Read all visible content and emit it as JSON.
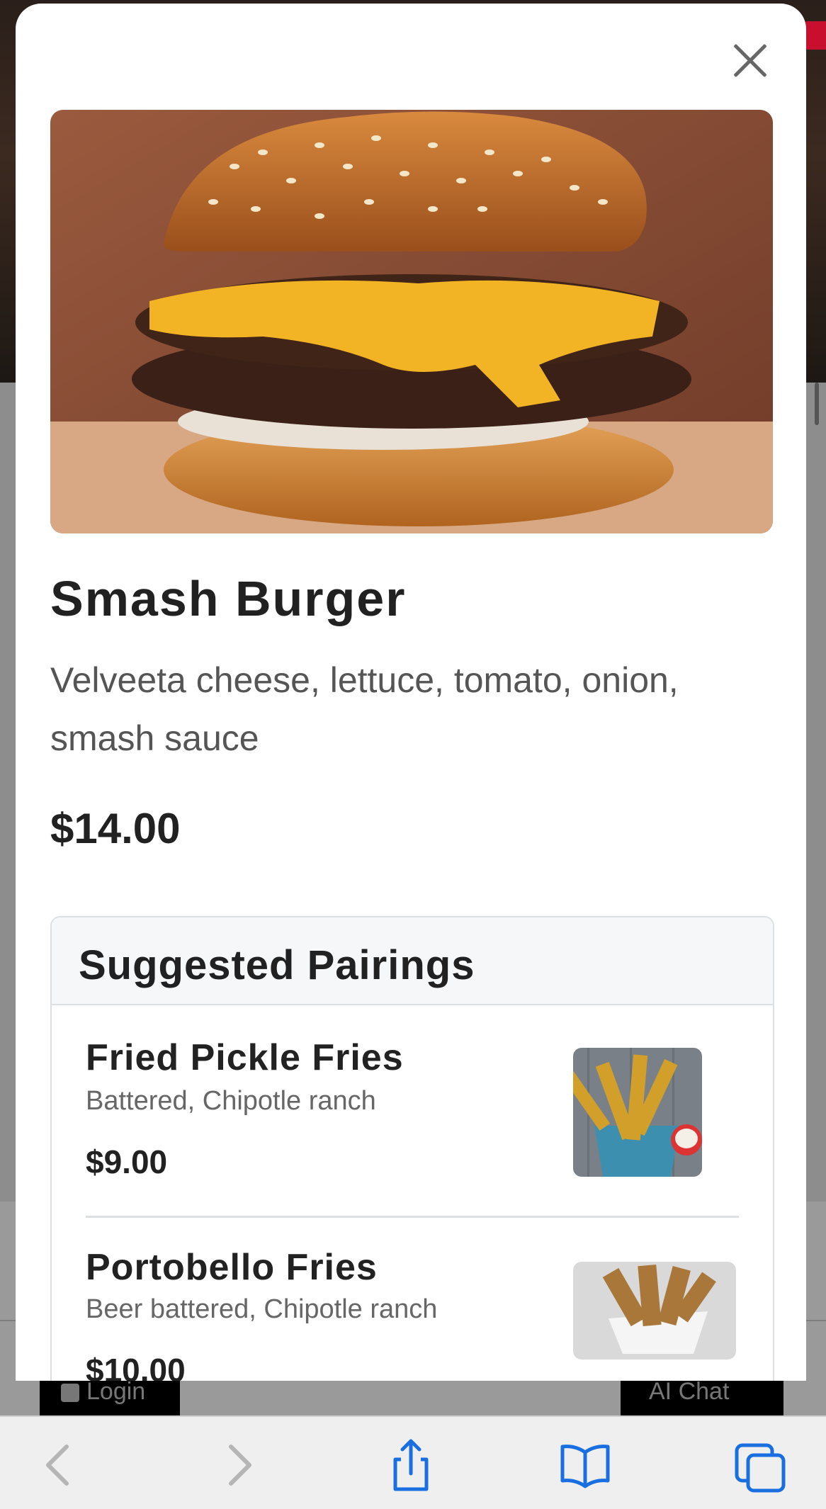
{
  "modal": {
    "close_label": "Close",
    "dish": {
      "name": "Smash Burger",
      "description": "Velveeta cheese, lettuce, tomato, onion, smash sauce",
      "price": "$14.00"
    },
    "pairings": {
      "title": "Suggested Pairings",
      "items": [
        {
          "name": "Fried Pickle Fries",
          "description": "Battered, Chipotle ranch",
          "price": "$9.00"
        },
        {
          "name": "Portobello Fries",
          "description": "Beer battered, Chipotle ranch",
          "price": "$10.00"
        }
      ]
    }
  },
  "background": {
    "login_label": "Login",
    "chat_label": "AI Chat"
  },
  "toolbar": {
    "icons": [
      "back-icon",
      "forward-icon",
      "share-icon",
      "bookmarks-icon",
      "tabs-icon"
    ],
    "accent_color": "#1a6fe0",
    "disabled_color": "#b5b5b5"
  }
}
